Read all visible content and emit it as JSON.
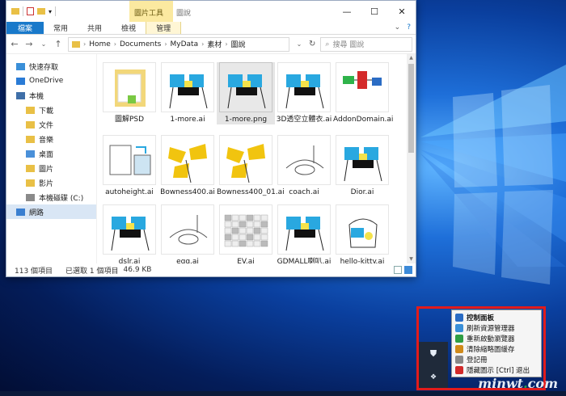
{
  "window": {
    "context_tab_group": "圖片工具",
    "title": "圖說",
    "controls": {
      "minimize": "—",
      "maximize": "☐",
      "close": "✕"
    }
  },
  "ribbon": {
    "tabs": [
      "檔案",
      "常用",
      "共用",
      "檢視",
      "管理"
    ],
    "help": "?"
  },
  "address": {
    "path": [
      "Home",
      "Documents",
      "MyData",
      "素材",
      "圖說"
    ],
    "search_placeholder": "搜尋 圖說"
  },
  "nav": {
    "items": [
      {
        "label": "快速存取",
        "icon": "star-icon",
        "indent": 0
      },
      {
        "label": "OneDrive",
        "icon": "cloud-icon",
        "indent": 0
      },
      {
        "label": "本機",
        "icon": "computer-icon",
        "indent": 0
      },
      {
        "label": "下載",
        "icon": "download-folder-icon",
        "indent": 1
      },
      {
        "label": "文件",
        "icon": "documents-folder-icon",
        "indent": 1
      },
      {
        "label": "音樂",
        "icon": "music-folder-icon",
        "indent": 1
      },
      {
        "label": "桌面",
        "icon": "desktop-folder-icon",
        "indent": 1
      },
      {
        "label": "圖片",
        "icon": "pictures-folder-icon",
        "indent": 1
      },
      {
        "label": "影片",
        "icon": "videos-folder-icon",
        "indent": 1
      },
      {
        "label": "本機磁碟 (C:)",
        "icon": "drive-icon",
        "indent": 1
      },
      {
        "label": "網路",
        "icon": "network-icon",
        "indent": 0,
        "selected": true
      }
    ]
  },
  "files": [
    {
      "name": "圖解PSD",
      "kind": "folder"
    },
    {
      "name": "1-more.ai",
      "kind": "studio"
    },
    {
      "name": "1-more.png",
      "kind": "studio",
      "selected": true
    },
    {
      "name": "3D透空立體衣.ai",
      "kind": "studio"
    },
    {
      "name": "AddonDomain.ai",
      "kind": "diagram"
    },
    {
      "name": "autoheight.ai",
      "kind": "window"
    },
    {
      "name": "Bowness400.ai",
      "kind": "yellow"
    },
    {
      "name": "Bowness400_01.ai",
      "kind": "yellow"
    },
    {
      "name": "coach.ai",
      "kind": "sketch"
    },
    {
      "name": "Dior.ai",
      "kind": "studio"
    },
    {
      "name": "dslr.ai",
      "kind": "studio"
    },
    {
      "name": "egg.ai",
      "kind": "sketch"
    },
    {
      "name": "EV.ai",
      "kind": "grid"
    },
    {
      "name": "GDMALL喇叭.ai",
      "kind": "studio"
    },
    {
      "name": "hello-kitty.ai",
      "kind": "kettle"
    }
  ],
  "status": {
    "count": "113 個項目",
    "selection": "已選取 1 個項目",
    "size": "46.9 KB"
  },
  "tray_menu": {
    "items": [
      {
        "label": "控制面板",
        "bold": true,
        "color": "#2b6cc4"
      },
      {
        "label": "刷新資源管理器",
        "bold": false,
        "color": "#3a8fd8"
      },
      {
        "label": "重新啟動瀏覽器",
        "bold": false,
        "color": "#2f9e44"
      },
      {
        "label": "清除縮略圖緩存",
        "bold": false,
        "color": "#d08a1a"
      },
      {
        "label": "登記冊",
        "bold": false,
        "color": "#888888"
      },
      {
        "label": "隱藏圖示 [Ctrl] 退出",
        "bold": false,
        "color": "#d12a2a"
      }
    ]
  },
  "watermark": {
    "prefix": "minwt",
    "dot": ".",
    "suffix": "com"
  }
}
